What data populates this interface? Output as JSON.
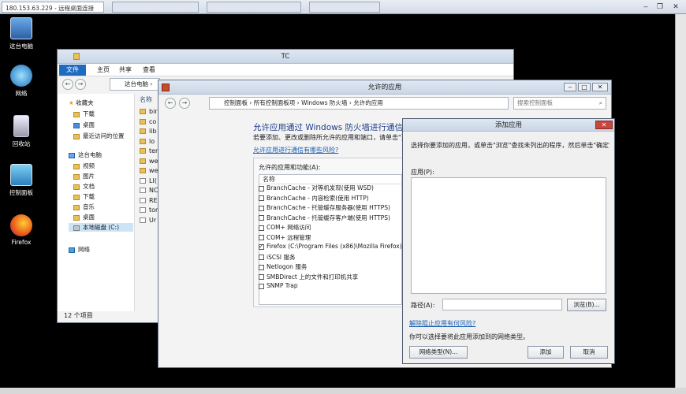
{
  "rdp": {
    "title": "180.153.63.229 - 远程桌面连接",
    "tab2": "",
    "tab3": "",
    "tab4": "",
    "min": "▭",
    "restore": "▭",
    "close": "✕"
  },
  "desktop": {
    "icons": [
      {
        "label": "这台电脑",
        "icon": "computer-icon"
      },
      {
        "label": "网络",
        "icon": "network-icon"
      },
      {
        "label": "回收站",
        "icon": "recycle-bin-icon"
      },
      {
        "label": "控制面板",
        "icon": "control-panel-icon"
      },
      {
        "label": "Firefox",
        "icon": "firefox-icon"
      }
    ]
  },
  "explorer": {
    "title": "TC",
    "ribbon_tabs": [
      "文件",
      "主页",
      "共享",
      "查看"
    ],
    "address": "这台电脑 ›",
    "column_name": "名称",
    "tree": [
      {
        "label": "收藏夹",
        "indent": 0
      },
      {
        "label": "下载",
        "indent": 1
      },
      {
        "label": "桌面",
        "indent": 1
      },
      {
        "label": "最近访问的位置",
        "indent": 1
      },
      {
        "label": "这台电脑",
        "indent": 0
      },
      {
        "label": "视频",
        "indent": 1
      },
      {
        "label": "图片",
        "indent": 1
      },
      {
        "label": "文档",
        "indent": 1
      },
      {
        "label": "下载",
        "indent": 1
      },
      {
        "label": "音乐",
        "indent": 1
      },
      {
        "label": "桌面",
        "indent": 1
      },
      {
        "label": "本地磁盘 (C:)",
        "indent": 1
      },
      {
        "label": "网络",
        "indent": 0
      }
    ],
    "files": [
      "bir",
      "co",
      "lib",
      "lo",
      "ter",
      "we",
      "we",
      "LI(",
      "NC",
      "RE",
      "tor",
      "Ur"
    ],
    "status": "12 个项目"
  },
  "firewall": {
    "title": "允许的应用",
    "breadcrumb": [
      "控制面板",
      "所有控制面板项",
      "Windows 防火墙",
      "允许的应用"
    ],
    "search_placeholder": "搜索控制面板",
    "heading": "允许应用通过 Windows 防火墙进行通信",
    "desc": "若要添加、更改或删除所允许的应用和端口，请单击\"更改设",
    "risk_link": "允许应用进行通信有哪些风险?",
    "group_label": "允许的应用和功能(A):",
    "col_name": "名称",
    "apps": [
      {
        "name": "BranchCache - 对等机发现(使用 WSD)",
        "checked": false
      },
      {
        "name": "BranchCache - 内容检索(使用 HTTP)",
        "checked": false
      },
      {
        "name": "BranchCache - 托管缓存服务器(使用 HTTPS)",
        "checked": false
      },
      {
        "name": "BranchCache - 托管缓存客户端(使用 HTTPS)",
        "checked": false
      },
      {
        "name": "COM+ 网络访问",
        "checked": false
      },
      {
        "name": "COM+ 远程管理",
        "checked": false
      },
      {
        "name": "Firefox (C:\\Program Files (x86)\\Mozilla Firefox)",
        "checked": true
      },
      {
        "name": "iSCSI 服务",
        "checked": false
      },
      {
        "name": "Netlogon 服务",
        "checked": false
      },
      {
        "name": "SMBDirect 上的文件和打印机共享",
        "checked": false
      },
      {
        "name": "SNMP Trap",
        "checked": false
      }
    ]
  },
  "add_dialog": {
    "title": "添加应用",
    "instructions": "选择你要添加的应用，或单击\"浏览\"查找未列出的程序，然后单击\"确定\"。",
    "apps_label": "应用(P):",
    "path_label": "路径(A):",
    "path_value": "",
    "browse": "浏览(B)...",
    "unblock_link": "解除阻止应用有何风险?",
    "network_hint": "你可以选择要将此应用添加到的网络类型。",
    "network_types": "网络类型(N)...",
    "add": "添加",
    "cancel": "取消",
    "close": "✕"
  }
}
